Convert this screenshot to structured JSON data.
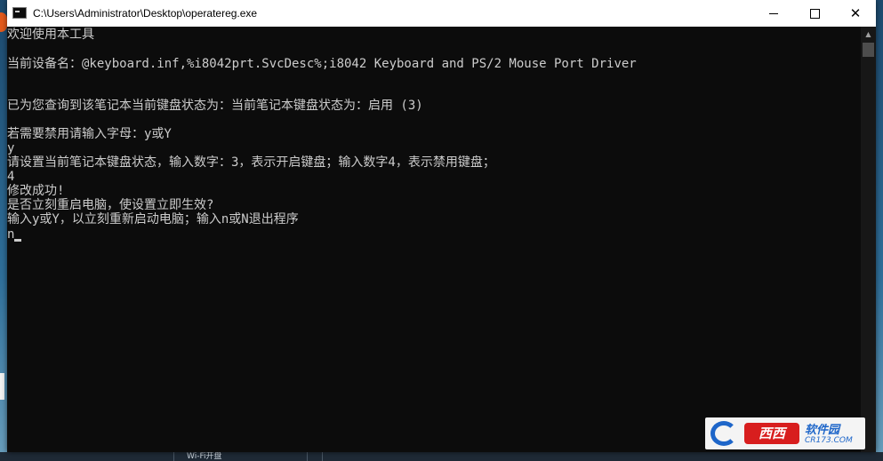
{
  "window": {
    "title": "C:\\Users\\Administrator\\Desktop\\operatereg.exe",
    "minimize_label": "—",
    "maximize_label": "☐",
    "close_label": "✕"
  },
  "console": {
    "lines": [
      "欢迎使用本工具",
      "当前设备名：@keyboard.inf,%i8042prt.SvcDesc%;i8042 Keyboard and PS/2 Mouse Port Driver",
      "已为您查询到该笔记本当前键盘状态为：当前笔记本键盘状态为：启用 (3)",
      "若需要禁用请输入字母：y或Y",
      "y",
      "请设置当前笔记本键盘状态，输入数字：3，表示开启键盘；输入数字4，表示禁用键盘；",
      "4",
      "修改成功!",
      "是否立刻重启电脑，使设置立即生效?",
      "输入y或Y，以立刻重新启动电脑；输入n或N退出程序",
      "n"
    ],
    "text_color": "#cccccc",
    "background": "#0c0c0c"
  },
  "watermark": {
    "brand": "西西",
    "name": "软件园",
    "site": "CR173.COM"
  },
  "taskbar": {
    "items": [
      "Wi-Fi开盘"
    ]
  },
  "icons": {
    "console_app": "console-window-icon",
    "minimize": "minimize-icon",
    "maximize": "maximize-icon",
    "close": "close-icon",
    "scroll_up": "scroll-up-arrow-icon"
  }
}
